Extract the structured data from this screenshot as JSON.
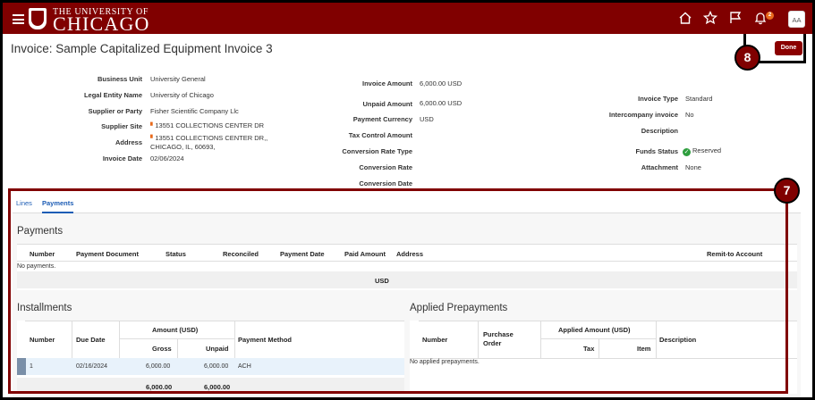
{
  "header": {
    "logo_top": "THE UNIVERSITY OF",
    "logo_main": "CHICAGO",
    "notification_count": "2",
    "user_initials": "AA"
  },
  "page": {
    "title": "Invoice: Sample Capitalized Equipment Invoice 3",
    "done_label": "Done"
  },
  "callouts": {
    "done": "8",
    "section": "7"
  },
  "details": {
    "left": [
      {
        "label": "Business Unit",
        "value": "University General"
      },
      {
        "label": "Legal Entity Name",
        "value": "University of Chicago"
      },
      {
        "label": "Supplier or Party",
        "value": "Fisher Scientific Company Llc"
      },
      {
        "label": "Supplier Site",
        "value": "13551 COLLECTIONS CENTER DR"
      },
      {
        "label": "Address",
        "value": "13551 COLLECTIONS CENTER DR,,",
        "value2": "CHICAGO, IL, 60693,"
      },
      {
        "label": "Invoice Date",
        "value": "02/06/2024"
      }
    ],
    "middle": [
      {
        "label": "Invoice Amount",
        "value": "6,000.00 USD"
      },
      {
        "label": "Unpaid Amount",
        "value": "6,000.00 USD"
      },
      {
        "label": "Payment Currency",
        "value": "USD"
      },
      {
        "label": "Tax Control Amount",
        "value": ""
      },
      {
        "label": "Conversion Rate Type",
        "value": ""
      },
      {
        "label": "Conversion Rate",
        "value": ""
      },
      {
        "label": "Conversion Date",
        "value": ""
      }
    ],
    "right": [
      {
        "label": "Invoice Type",
        "value": "Standard"
      },
      {
        "label": "Intercompany invoice",
        "value": "No"
      },
      {
        "label": "Description",
        "value": ""
      },
      {
        "label": "Funds Status",
        "value": "Reserved"
      },
      {
        "label": "Attachment",
        "value": "None"
      }
    ]
  },
  "tabs": [
    {
      "label": "Lines"
    },
    {
      "label": "Payments"
    }
  ],
  "payments": {
    "heading": "Payments",
    "columns": [
      "Number",
      "Payment Document",
      "Status",
      "Reconciled",
      "Payment Date",
      "Paid Amount",
      "Address",
      "Remit-to Account"
    ],
    "empty_text": "No payments.",
    "total_currency": "USD"
  },
  "installments": {
    "heading": "Installments",
    "col_number": "Number",
    "col_due_date": "Due Date",
    "col_amount_group": "Amount (USD)",
    "col_gross": "Gross",
    "col_unpaid": "Unpaid",
    "col_payment_method": "Payment Method",
    "rows": [
      {
        "number": "1",
        "due_date": "02/16/2024",
        "gross": "6,000.00",
        "unpaid": "6,000.00",
        "method": "ACH"
      }
    ],
    "total_gross": "6,000.00",
    "total_unpaid": "6,000.00"
  },
  "prepayments": {
    "heading": "Applied Prepayments",
    "col_number": "Number",
    "col_po": "Purchase Order",
    "col_applied_group": "Applied Amount (USD)",
    "col_tax": "Tax",
    "col_item": "Item",
    "col_description": "Description",
    "empty_text": "No applied prepayments."
  },
  "colors": {
    "brand": "#800000",
    "link": "#1d5db5",
    "notification": "#e86a1c",
    "status_ok": "#2e9e3e"
  },
  "icons": [
    "hamburger-icon",
    "home-icon",
    "star-icon",
    "flag-icon",
    "bell-icon",
    "check-circle-icon"
  ]
}
